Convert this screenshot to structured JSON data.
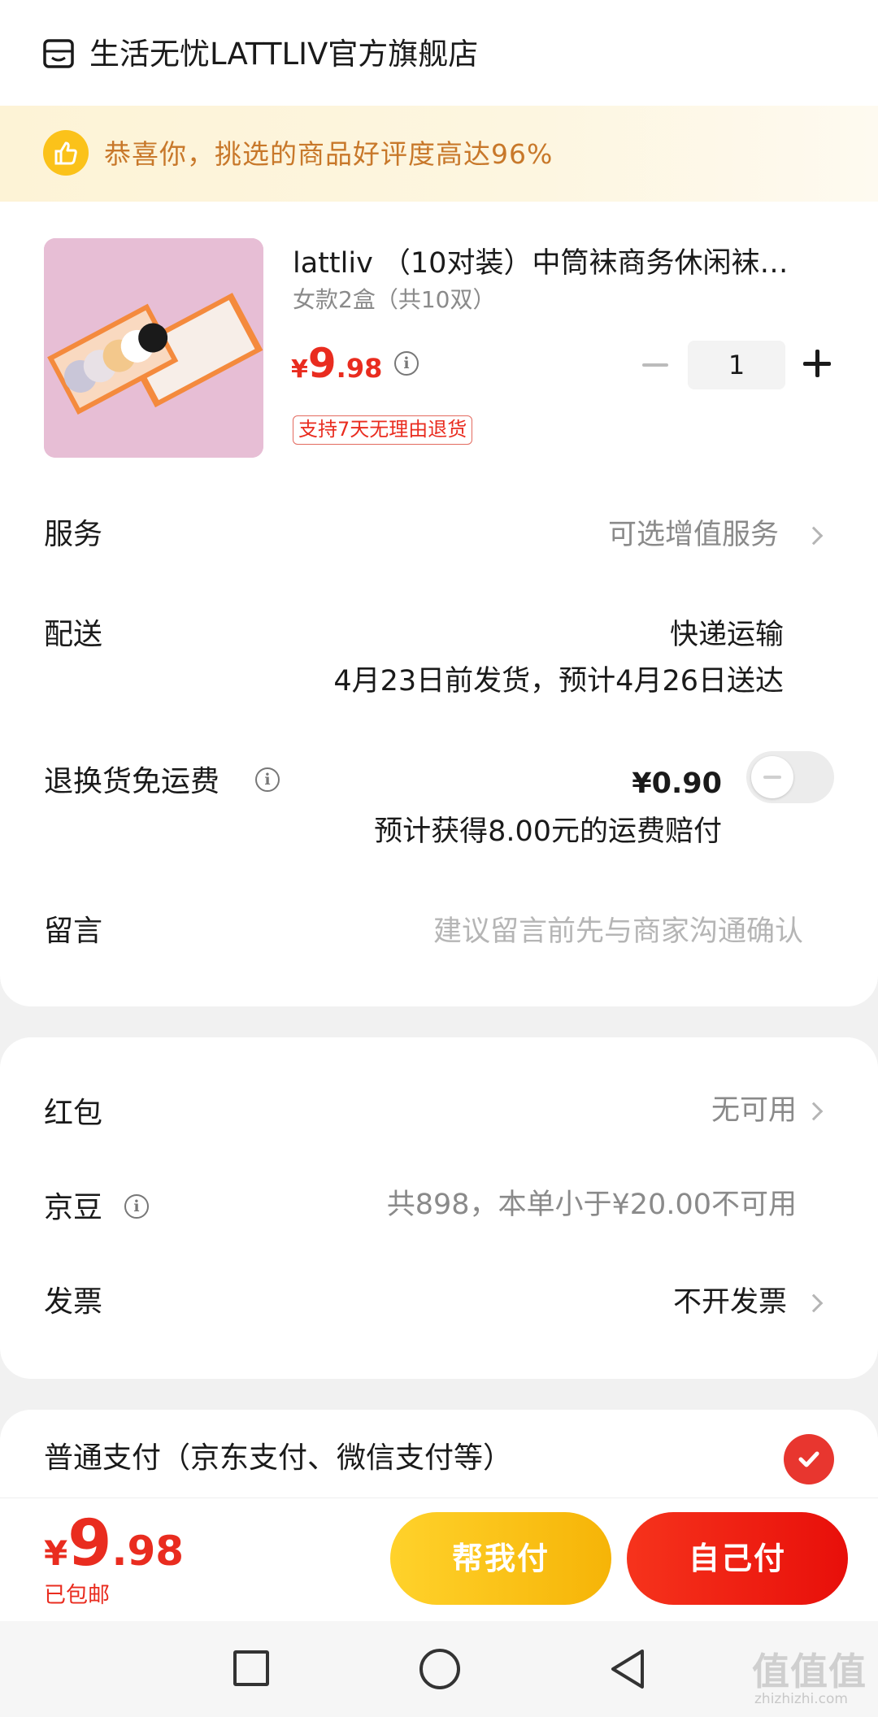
{
  "store": {
    "icon": "store-icon",
    "name": "生活无忧LATTLIV官方旗舰店"
  },
  "banner": {
    "icon": "thumbs-up-icon",
    "text": "恭喜你，挑选的商品好评度高达96%"
  },
  "product": {
    "title": "lattliv （10对装）中筒袜商务休闲袜…",
    "variant": "女款2盒（共10双）",
    "price_currency": "¥",
    "price_int": "9",
    "price_dec": ".98",
    "quantity": "1",
    "return_badge": "支持7天无理由退货"
  },
  "service": {
    "label": "服务",
    "value": "可选增值服务"
  },
  "delivery": {
    "label": "配送",
    "method": "快递运输",
    "schedule": "4月23日前发货，预计4月26日送达"
  },
  "return_shipping": {
    "label": "退换货免运费",
    "price": "¥0.90",
    "note": "预计获得8.00元的运费赔付",
    "enabled": false
  },
  "message": {
    "label": "留言",
    "placeholder": "建议留言前先与商家沟通确认"
  },
  "red_packet": {
    "label": "红包",
    "value": "无可用"
  },
  "jd_beans": {
    "label": "京豆",
    "value": "共898，本单小于¥20.00不可用"
  },
  "invoice": {
    "label": "发票",
    "value": "不开发票"
  },
  "payment": {
    "label": "普通支付（京东支付、微信支付等）",
    "selected": true
  },
  "footer": {
    "total_currency": "¥",
    "total_int": "9",
    "total_dec": ".98",
    "shipping": "已包邮",
    "help_pay": "帮我付",
    "self_pay": "自己付"
  },
  "navbar": {
    "recents_icon": "square-icon",
    "home_icon": "circle-icon",
    "back_icon": "triangle-back-icon"
  },
  "watermark": {
    "text": "值值值",
    "sub": "zhizhizhi.com"
  },
  "colors": {
    "accent_red": "#e92c1f",
    "help_yellow": "#f6b407",
    "banner_text": "#c8782a"
  }
}
